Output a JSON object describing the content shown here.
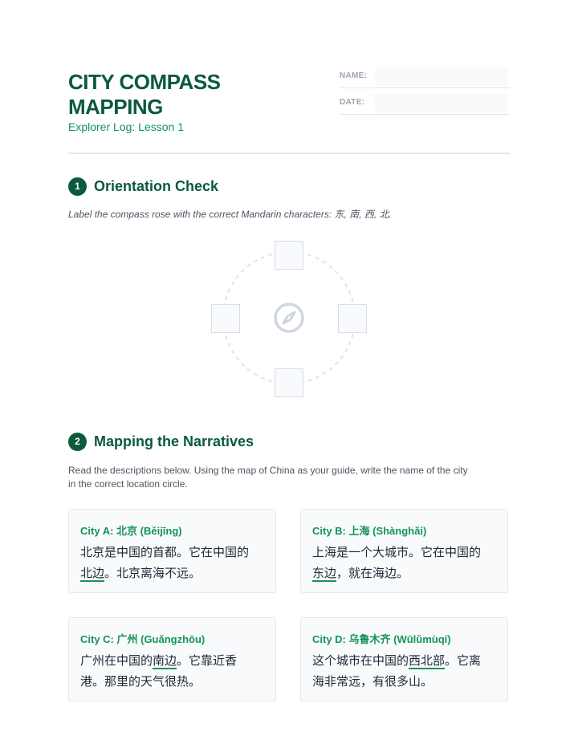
{
  "header": {
    "title_line1": "CITY COMPASS",
    "title_line2": "MAPPING",
    "subtitle": "Explorer Log: Lesson 1",
    "name_label": "NAME:",
    "date_label": "DATE:"
  },
  "section1": {
    "number": "1",
    "title": "Orientation Check",
    "instruction": "Label the compass rose with the correct Mandarin characters: 东, 南, 西, 北."
  },
  "section2": {
    "number": "2",
    "title": "Mapping the Narratives",
    "instruction_line1": "Read the descriptions below. Using the map of China as your guide, write the name of the city",
    "instruction_line2": "in the correct location circle."
  },
  "cards": [
    {
      "title": "City A: 北京 (Běijīng)",
      "line1": "北京是中国的首都。它在中国的",
      "line2_pre": "",
      "line2_ul": "北边",
      "line2_post": "。北京离海不远。"
    },
    {
      "title": "City B: 上海 (Shànghǎi)",
      "line1": "上海是一个大城市。它在中国的",
      "line2_pre": "",
      "line2_ul": "东边",
      "line2_post": "，就在海边。"
    },
    {
      "title": "City C: 广州 (Guǎngzhōu)",
      "line1_pre": "广州在中国的",
      "line1_ul": "南边",
      "line1_post": "。它靠近香",
      "line2": "港。那里的天气很热。"
    },
    {
      "title": "City D: 乌鲁木齐 (Wūlǔmùqí)",
      "line1_pre": "这个城市在中国的",
      "line1_ul": "西北部",
      "line1_post": "。它离",
      "line2": "海非常远，有很多山。"
    }
  ],
  "icons": {
    "compass_center": "compass-icon"
  },
  "colors": {
    "brand_dark": "#0b5a3b",
    "brand_accent": "#15935a"
  }
}
